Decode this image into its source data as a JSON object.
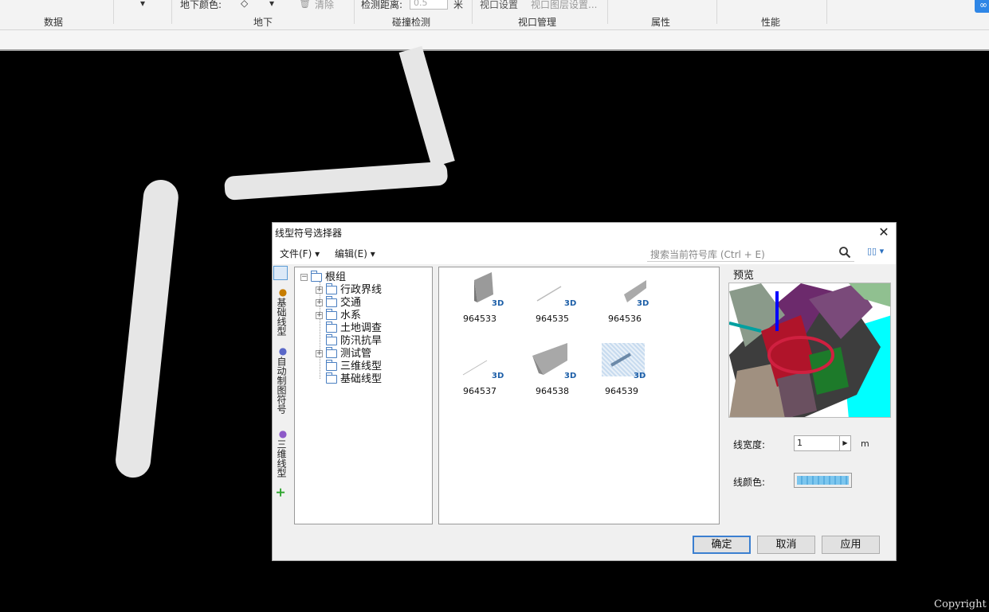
{
  "ribbon": {
    "groups": [
      "数据",
      "地下",
      "碰撞检测",
      "视口管理",
      "属性",
      "性能"
    ],
    "underground_color_label": "地下颜色:",
    "clear_label": "清除",
    "detect_distance_label": "检测距离:",
    "detect_distance_value": "0.5",
    "detect_distance_unit": "米",
    "viewport_setting_label": "视口设置",
    "viewport_layer_setting_label": "视口图层设置..."
  },
  "dialog": {
    "title": "线型符号选择器",
    "menu": {
      "file": "文件(F)",
      "edit": "编辑(E)"
    },
    "search_placeholder": "搜索当前符号库 (Ctrl + E)",
    "side_tabs": [
      "基础线型",
      "自动制图符号",
      "三维线型"
    ],
    "tree": {
      "root": "根组",
      "children": [
        {
          "label": "行政界线",
          "expandable": true
        },
        {
          "label": "交通",
          "expandable": true
        },
        {
          "label": "水系",
          "expandable": true
        },
        {
          "label": "土地调查",
          "expandable": false
        },
        {
          "label": "防汛抗旱",
          "expandable": false
        },
        {
          "label": "测试管",
          "expandable": true
        },
        {
          "label": "三维线型",
          "expandable": false
        },
        {
          "label": "基础线型",
          "expandable": false
        }
      ]
    },
    "symbols": [
      {
        "id": "964533",
        "badge": "3D"
      },
      {
        "id": "964535",
        "badge": "3D"
      },
      {
        "id": "964536",
        "badge": "3D"
      },
      {
        "id": "964537",
        "badge": "3D"
      },
      {
        "id": "964538",
        "badge": "3D"
      },
      {
        "id": "964539",
        "badge": "3D",
        "selected": true
      }
    ],
    "preview_label": "预览",
    "line_width_label": "线宽度:",
    "line_width_value": "1",
    "line_width_unit": "m",
    "line_color_label": "线颜色:",
    "buttons": {
      "ok": "确定",
      "cancel": "取消",
      "apply": "应用"
    }
  },
  "footer": {
    "copyright": "Copyright"
  }
}
